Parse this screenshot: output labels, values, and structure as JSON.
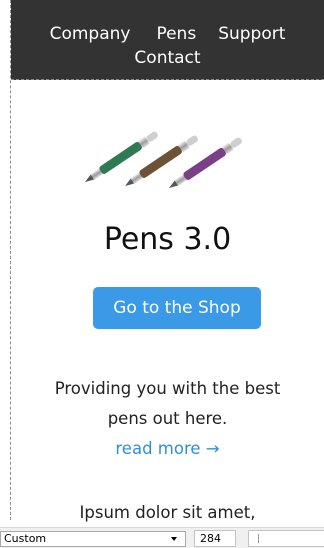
{
  "navbar": {
    "links": [
      "Company",
      "Pens",
      "Support",
      "Contact"
    ]
  },
  "hero": {
    "pen_colors": [
      "#2f7a52",
      "#6e5236",
      "#7a3f86"
    ]
  },
  "main": {
    "title": "Pens 3.0",
    "shop_button": "Go to the Shop",
    "description_lines": [
      "Providing you with the best",
      "pens out here."
    ],
    "read_more": "read more →",
    "next_text": "Ipsum dolor sit amet,"
  },
  "statusbar": {
    "size_preset": "Custom",
    "width_value": "284"
  },
  "colors": {
    "navbar_bg": "#333333",
    "accent": "#3a9ae8",
    "link": "#2e8fe0"
  }
}
